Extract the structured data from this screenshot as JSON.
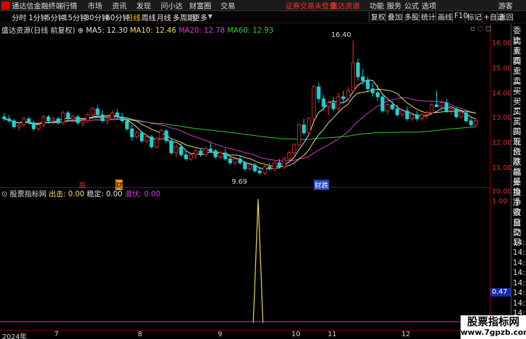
{
  "titlebar": {
    "app_name": "通达信金融终端",
    "menu": [
      "行情",
      "市场",
      "资讯",
      "发现",
      "问小达",
      "财富圈",
      "交易"
    ],
    "notice": "证券交易未登录",
    "link": "盛达资源",
    "right": [
      "功能",
      "服务",
      "公式",
      "选项"
    ],
    "user": "游客",
    "colors": {
      "notice": "#ff3030"
    }
  },
  "toolbar": {
    "periods": [
      "分时",
      "1分钟",
      "5分钟",
      "15分钟",
      "30分钟",
      "60分钟",
      "日线",
      "周线",
      "月线",
      "多周期",
      "更多"
    ],
    "selected": "日线",
    "buttons": [
      "复权",
      "叠加",
      "多股",
      "统计",
      "画线",
      "F10",
      "标记",
      "+自选",
      "返回"
    ]
  },
  "main_info": {
    "stock": "盛达资源(日线 前复权)",
    "ma5": "MA5: 12.30",
    "ma10": "MA10: 12.46",
    "ma20": "MA20: 12.78",
    "ma60": "MA60: 12.93"
  },
  "indicator": {
    "name": "股票指标网",
    "out": "出击: 0.00",
    "stable": "稳定: 0.00",
    "ambush": "潜伏: 0.00"
  },
  "price_scale": [
    "16.00",
    "15.00",
    "14.00",
    "13.00",
    "12.00",
    "11.00",
    "10.00"
  ],
  "ind_scale": [
    "1.00",
    "0.47"
  ],
  "high_label": "16.40",
  "low_label": "9.69",
  "markers": {
    "m1": "高",
    "m2": "财",
    "m3": "跌"
  },
  "date_axis": [
    "2024年",
    "7",
    "8",
    "9",
    "10",
    "11",
    "12"
  ],
  "sidebar_labels": [
    "委比",
    "卖五",
    "卖四",
    "卖三",
    "卖二",
    "卖一",
    "买一",
    "买二",
    "买三",
    "买四",
    "买五",
    "现价",
    "涨跌",
    "涨幅",
    "总量",
    "外盘",
    "换手",
    "净资",
    "收益",
    "自动",
    "交易",
    "14:5",
    "14:5",
    "14:5",
    "14:5",
    "14:5",
    "14:5",
    "14:5",
    "14:5",
    "14:5"
  ],
  "watermark": {
    "line1": "股票指标网",
    "line2": "www.7gpzb.com"
  },
  "chart_data": {
    "type": "candlestick",
    "candles": [
      [
        12.6,
        12.8,
        12.4,
        12.5
      ],
      [
        12.5,
        12.7,
        12.3,
        12.4
      ],
      [
        12.4,
        12.5,
        12.0,
        12.1
      ],
      [
        12.1,
        12.3,
        11.9,
        12.2
      ],
      [
        12.2,
        12.6,
        12.1,
        12.5
      ],
      [
        12.5,
        12.6,
        12.2,
        12.3
      ],
      [
        12.3,
        12.4,
        11.9,
        12.0
      ],
      [
        12.0,
        12.3,
        11.9,
        12.2
      ],
      [
        12.2,
        12.7,
        12.1,
        12.6
      ],
      [
        12.6,
        12.7,
        12.3,
        12.4
      ],
      [
        12.4,
        12.6,
        12.2,
        12.5
      ],
      [
        12.5,
        12.6,
        12.2,
        12.3
      ],
      [
        12.3,
        12.9,
        12.2,
        12.8
      ],
      [
        12.8,
        12.9,
        12.4,
        12.5
      ],
      [
        12.5,
        12.7,
        12.3,
        12.6
      ],
      [
        12.6,
        12.7,
        12.2,
        12.3
      ],
      [
        12.3,
        12.5,
        12.1,
        12.4
      ],
      [
        12.4,
        12.8,
        12.3,
        12.7
      ],
      [
        12.7,
        13.1,
        12.6,
        13.0
      ],
      [
        13.0,
        13.2,
        12.6,
        12.7
      ],
      [
        12.7,
        12.9,
        12.3,
        12.4
      ],
      [
        12.4,
        12.6,
        12.2,
        12.5
      ],
      [
        12.5,
        12.9,
        12.4,
        12.8
      ],
      [
        12.8,
        13.0,
        12.5,
        12.6
      ],
      [
        12.6,
        12.8,
        12.3,
        12.4
      ],
      [
        12.4,
        12.5,
        11.9,
        12.0
      ],
      [
        12.0,
        12.2,
        11.4,
        11.6
      ],
      [
        11.6,
        11.9,
        11.5,
        11.8
      ],
      [
        11.8,
        11.9,
        11.3,
        11.4
      ],
      [
        11.4,
        11.7,
        11.3,
        11.6
      ],
      [
        11.6,
        11.7,
        11.0,
        11.1
      ],
      [
        11.1,
        11.6,
        11.0,
        11.5
      ],
      [
        11.5,
        12.0,
        11.4,
        11.9
      ],
      [
        11.9,
        12.0,
        11.3,
        11.4
      ],
      [
        11.4,
        11.5,
        10.7,
        10.8
      ],
      [
        10.8,
        11.2,
        10.6,
        11.1
      ],
      [
        11.1,
        11.3,
        10.6,
        10.7
      ],
      [
        10.7,
        10.9,
        10.4,
        10.5
      ],
      [
        10.5,
        10.8,
        10.4,
        10.7
      ],
      [
        10.7,
        11.0,
        10.5,
        10.9
      ],
      [
        10.9,
        11.0,
        10.6,
        10.7
      ],
      [
        10.7,
        11.1,
        10.6,
        11.0
      ],
      [
        11.0,
        11.3,
        10.8,
        10.9
      ],
      [
        10.9,
        11.0,
        10.5,
        10.6
      ],
      [
        10.6,
        10.9,
        10.5,
        10.8
      ],
      [
        10.8,
        11.0,
        10.4,
        10.5
      ],
      [
        10.5,
        10.6,
        10.2,
        10.3
      ],
      [
        10.3,
        10.6,
        10.2,
        10.5
      ],
      [
        10.5,
        10.7,
        10.2,
        10.3
      ],
      [
        10.3,
        10.4,
        9.9,
        10.0
      ],
      [
        10.0,
        10.3,
        9.9,
        10.2
      ],
      [
        10.2,
        10.3,
        9.8,
        9.9
      ],
      [
        9.9,
        10.1,
        9.7,
        9.8
      ],
      [
        9.8,
        10.2,
        9.69,
        10.1
      ],
      [
        10.1,
        10.3,
        9.9,
        10.0
      ],
      [
        10.0,
        10.4,
        9.9,
        10.3
      ],
      [
        10.3,
        10.5,
        10.0,
        10.1
      ],
      [
        10.1,
        10.6,
        10.0,
        10.5
      ],
      [
        10.5,
        10.9,
        10.3,
        10.8
      ],
      [
        10.8,
        11.3,
        10.7,
        11.2
      ],
      [
        11.2,
        12.3,
        11.1,
        12.2
      ],
      [
        12.2,
        12.5,
        11.7,
        11.8
      ],
      [
        11.8,
        12.6,
        11.7,
        12.5
      ],
      [
        12.5,
        14.2,
        12.4,
        14.1
      ],
      [
        14.1,
        14.3,
        13.3,
        13.5
      ],
      [
        13.5,
        13.7,
        12.9,
        13.1
      ],
      [
        13.1,
        13.4,
        12.7,
        13.3
      ],
      [
        13.3,
        13.6,
        12.9,
        13.0
      ],
      [
        13.0,
        13.8,
        12.9,
        13.6
      ],
      [
        13.6,
        13.9,
        13.3,
        13.5
      ],
      [
        13.5,
        14.1,
        13.4,
        13.9
      ],
      [
        13.9,
        16.4,
        13.8,
        15.3
      ],
      [
        15.3,
        15.5,
        14.4,
        14.6
      ],
      [
        14.6,
        15.0,
        14.2,
        14.4
      ],
      [
        14.4,
        14.6,
        13.8,
        14.0
      ],
      [
        14.0,
        14.3,
        13.6,
        13.8
      ],
      [
        13.8,
        14.2,
        13.4,
        13.6
      ],
      [
        13.6,
        13.7,
        12.8,
        12.9
      ],
      [
        12.9,
        13.3,
        12.7,
        13.2
      ],
      [
        13.2,
        13.4,
        12.9,
        13.0
      ],
      [
        13.0,
        13.2,
        12.6,
        12.7
      ],
      [
        12.7,
        13.0,
        12.6,
        12.9
      ],
      [
        12.9,
        13.1,
        12.4,
        12.5
      ],
      [
        12.5,
        12.8,
        12.4,
        12.7
      ],
      [
        12.7,
        12.9,
        12.4,
        12.5
      ],
      [
        12.5,
        12.8,
        12.4,
        12.7
      ],
      [
        12.7,
        12.9,
        12.5,
        12.8
      ],
      [
        12.8,
        13.3,
        12.7,
        13.2
      ],
      [
        13.2,
        13.9,
        13.1,
        13.1
      ],
      [
        13.1,
        13.4,
        12.9,
        13.3
      ],
      [
        13.3,
        13.5,
        12.8,
        12.9
      ],
      [
        12.9,
        13.1,
        12.7,
        13.0
      ],
      [
        13.0,
        13.1,
        12.5,
        12.6
      ],
      [
        12.6,
        12.9,
        12.5,
        12.8
      ],
      [
        12.8,
        12.9,
        12.3,
        12.4
      ],
      [
        12.4,
        12.6,
        12.1,
        12.2
      ],
      [
        12.2,
        12.5,
        12.1,
        12.4
      ]
    ],
    "ylim": [
      9.5,
      16.8
    ]
  }
}
